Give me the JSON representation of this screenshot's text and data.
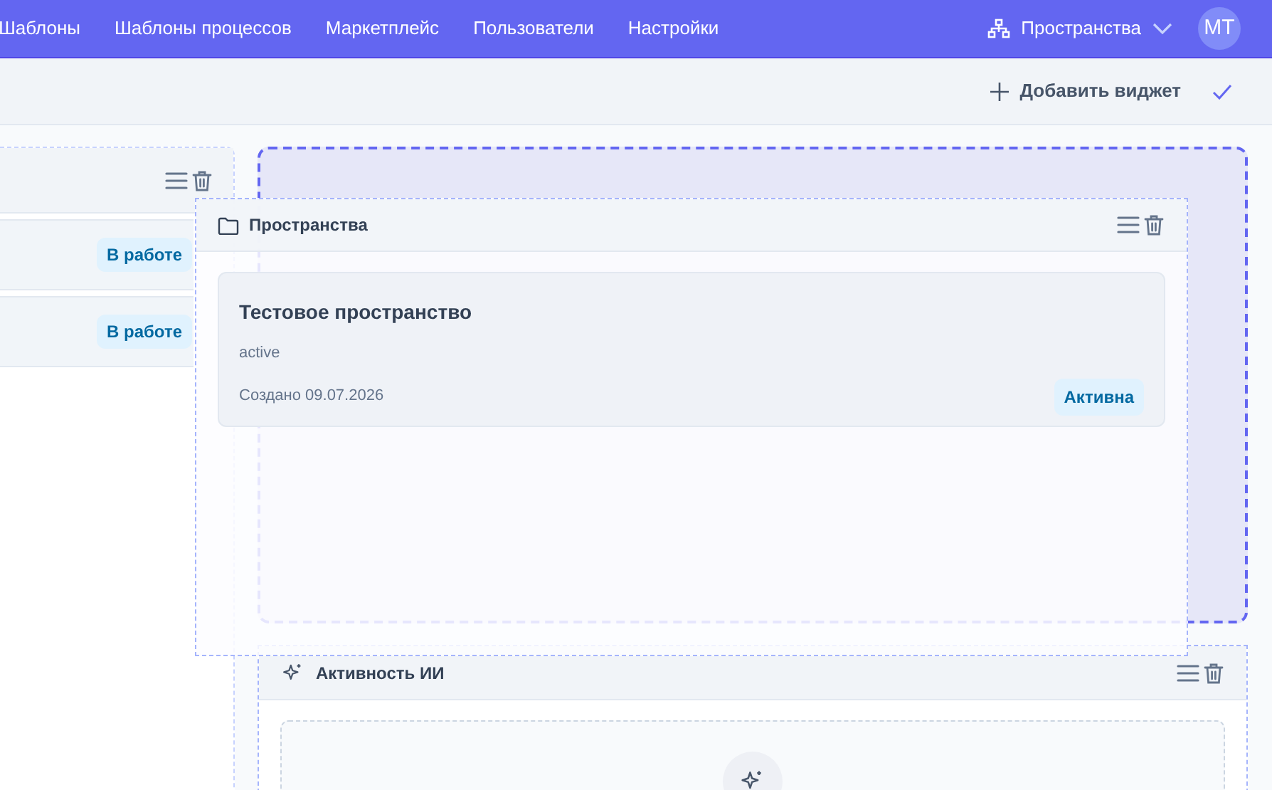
{
  "nav": {
    "items": [
      {
        "label": "Шаблоны"
      },
      {
        "label": "Шаблоны процессов"
      },
      {
        "label": "Маркетплейс"
      },
      {
        "label": "Пользователи"
      },
      {
        "label": "Настройки"
      }
    ],
    "space_switcher": "Пространства",
    "avatar": "MT"
  },
  "toolbar": {
    "add_widget": "Добавить виджет"
  },
  "left_widget": {
    "rows": [
      {
        "status": "В работе"
      },
      {
        "status": "В работе"
      }
    ]
  },
  "dragged_widget": {
    "title": "Пространства",
    "cards": [
      {
        "title": "Тестовое пространство",
        "subtitle": "active",
        "created": "Создано 09.07.2026",
        "status": "Активна"
      }
    ]
  },
  "ai_widget": {
    "title": "Активность ИИ"
  }
}
